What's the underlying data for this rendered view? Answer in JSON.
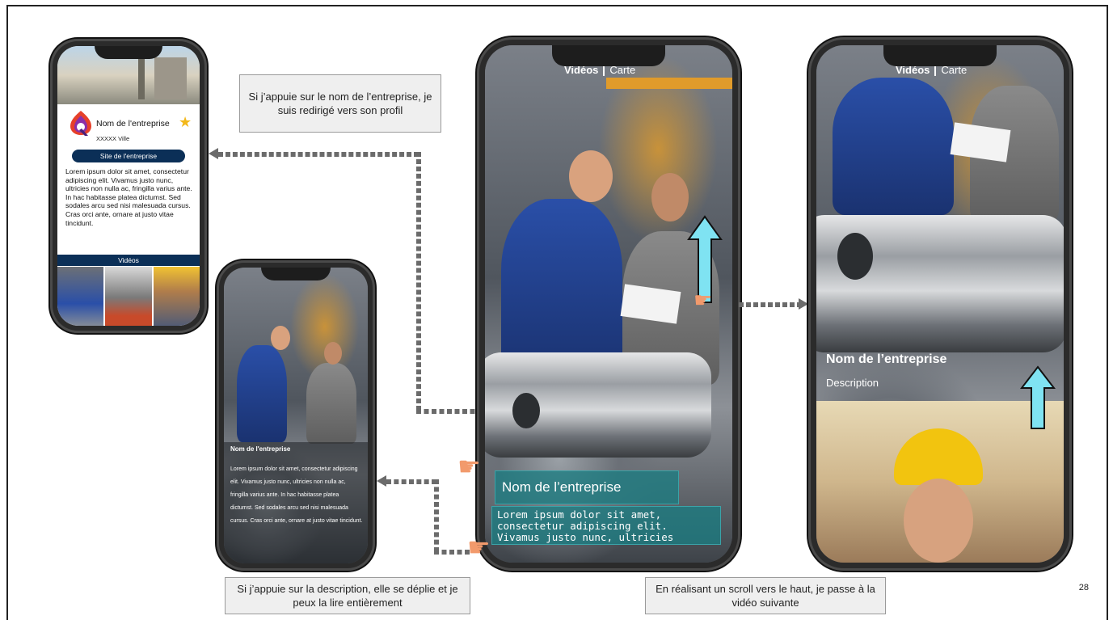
{
  "callouts": {
    "profile": "Si j’appuie sur le nom de l’entreprise, je suis redirigé vers son profil",
    "description": "Si j’appuie sur la description, elle se déplie et je peux la lire entièrement",
    "scroll": "En réalisant un scroll vers le haut, je passe à la vidéo suivante"
  },
  "profile_phone": {
    "company_name": "Nom de l'entreprise",
    "city": "XXXXX Ville",
    "site_button": "Site de l'entreprise",
    "description": "Lorem ipsum dolor sit amet, consectetur adipiscing elit. Vivamus justo nunc, ultricies non nulla ac, fringilla varius ante. In hac habitasse platea dictumst. Sed sodales arcu sed nisi malesuada cursus. Cras orci ante, ornare at justo vitae tincidunt.",
    "videos_label": "Vidéos"
  },
  "expanded_phone": {
    "company_name": "Nom de l'entreprise",
    "description": "Lorem ipsum dolor sit amet, consectetur adipiscing elit. Vivamus justo nunc, ultricies non nulla ac, fringilla varius ante. In hac habitasse platea dictumst. Sed sodales arcu sed nisi malesuada cursus. Cras orci ante, ornare at justo vitae tincidunt."
  },
  "main_phone": {
    "tab_videos": "Vidéos",
    "tab_map": "Carte",
    "company_name": "Nom de l’entreprise",
    "description": "Lorem ipsum dolor sit amet, consectetur adipiscing elit. Vivamus justo nunc, ultricies"
  },
  "next_phone": {
    "tab_videos": "Vidéos",
    "tab_map": "Carte",
    "company_name": "Nom de l’entreprise",
    "description": "Description"
  },
  "page_number": "28",
  "colors": {
    "navy": "#0b2f57",
    "teal": "#1b7c82",
    "arrow_cyan": "#7fe3f2",
    "dash": "#6b6b6b"
  },
  "icons": [
    "star-icon",
    "company-logo-icon",
    "up-arrow-icon",
    "hand-pointer-icon"
  ]
}
